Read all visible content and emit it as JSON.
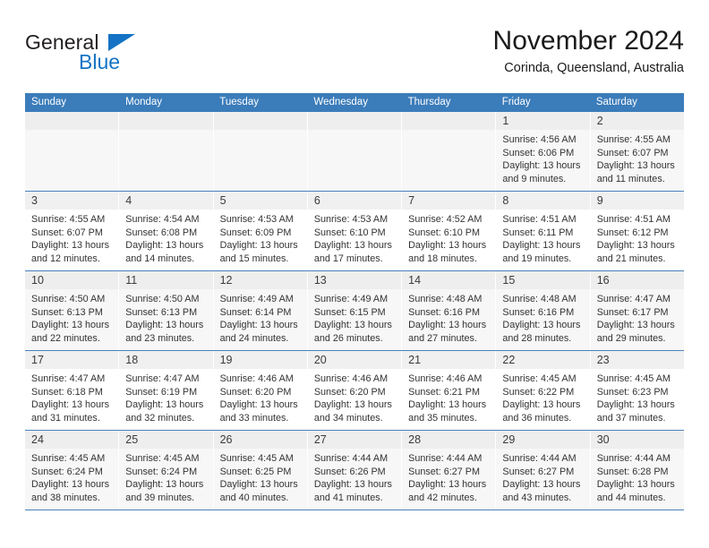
{
  "brand": {
    "word_one": "General",
    "word_two": "Blue",
    "accent_color": "#1473c4",
    "triangle_icon": "triangle-icon"
  },
  "header": {
    "title": "November 2024",
    "subtitle": "Corinda, Queensland, Australia"
  },
  "theme": {
    "header_blue": "#3b7cba",
    "row_divider": "#4a82bd",
    "band_gray": "#f0f0f0",
    "row_shade": "#f7f7f7"
  },
  "calendar": {
    "weekday_headers": [
      "Sunday",
      "Monday",
      "Tuesday",
      "Wednesday",
      "Thursday",
      "Friday",
      "Saturday"
    ],
    "weeks": [
      {
        "shaded": true,
        "days": [
          {
            "day": "",
            "lines": []
          },
          {
            "day": "",
            "lines": []
          },
          {
            "day": "",
            "lines": []
          },
          {
            "day": "",
            "lines": []
          },
          {
            "day": "",
            "lines": []
          },
          {
            "day": "1",
            "lines": [
              "Sunrise: 4:56 AM",
              "Sunset: 6:06 PM",
              "Daylight: 13 hours",
              "and 9 minutes."
            ]
          },
          {
            "day": "2",
            "lines": [
              "Sunrise: 4:55 AM",
              "Sunset: 6:07 PM",
              "Daylight: 13 hours",
              "and 11 minutes."
            ]
          }
        ]
      },
      {
        "shaded": false,
        "days": [
          {
            "day": "3",
            "lines": [
              "Sunrise: 4:55 AM",
              "Sunset: 6:07 PM",
              "Daylight: 13 hours",
              "and 12 minutes."
            ]
          },
          {
            "day": "4",
            "lines": [
              "Sunrise: 4:54 AM",
              "Sunset: 6:08 PM",
              "Daylight: 13 hours",
              "and 14 minutes."
            ]
          },
          {
            "day": "5",
            "lines": [
              "Sunrise: 4:53 AM",
              "Sunset: 6:09 PM",
              "Daylight: 13 hours",
              "and 15 minutes."
            ]
          },
          {
            "day": "6",
            "lines": [
              "Sunrise: 4:53 AM",
              "Sunset: 6:10 PM",
              "Daylight: 13 hours",
              "and 17 minutes."
            ]
          },
          {
            "day": "7",
            "lines": [
              "Sunrise: 4:52 AM",
              "Sunset: 6:10 PM",
              "Daylight: 13 hours",
              "and 18 minutes."
            ]
          },
          {
            "day": "8",
            "lines": [
              "Sunrise: 4:51 AM",
              "Sunset: 6:11 PM",
              "Daylight: 13 hours",
              "and 19 minutes."
            ]
          },
          {
            "day": "9",
            "lines": [
              "Sunrise: 4:51 AM",
              "Sunset: 6:12 PM",
              "Daylight: 13 hours",
              "and 21 minutes."
            ]
          }
        ]
      },
      {
        "shaded": true,
        "days": [
          {
            "day": "10",
            "lines": [
              "Sunrise: 4:50 AM",
              "Sunset: 6:13 PM",
              "Daylight: 13 hours",
              "and 22 minutes."
            ]
          },
          {
            "day": "11",
            "lines": [
              "Sunrise: 4:50 AM",
              "Sunset: 6:13 PM",
              "Daylight: 13 hours",
              "and 23 minutes."
            ]
          },
          {
            "day": "12",
            "lines": [
              "Sunrise: 4:49 AM",
              "Sunset: 6:14 PM",
              "Daylight: 13 hours",
              "and 24 minutes."
            ]
          },
          {
            "day": "13",
            "lines": [
              "Sunrise: 4:49 AM",
              "Sunset: 6:15 PM",
              "Daylight: 13 hours",
              "and 26 minutes."
            ]
          },
          {
            "day": "14",
            "lines": [
              "Sunrise: 4:48 AM",
              "Sunset: 6:16 PM",
              "Daylight: 13 hours",
              "and 27 minutes."
            ]
          },
          {
            "day": "15",
            "lines": [
              "Sunrise: 4:48 AM",
              "Sunset: 6:16 PM",
              "Daylight: 13 hours",
              "and 28 minutes."
            ]
          },
          {
            "day": "16",
            "lines": [
              "Sunrise: 4:47 AM",
              "Sunset: 6:17 PM",
              "Daylight: 13 hours",
              "and 29 minutes."
            ]
          }
        ]
      },
      {
        "shaded": false,
        "days": [
          {
            "day": "17",
            "lines": [
              "Sunrise: 4:47 AM",
              "Sunset: 6:18 PM",
              "Daylight: 13 hours",
              "and 31 minutes."
            ]
          },
          {
            "day": "18",
            "lines": [
              "Sunrise: 4:47 AM",
              "Sunset: 6:19 PM",
              "Daylight: 13 hours",
              "and 32 minutes."
            ]
          },
          {
            "day": "19",
            "lines": [
              "Sunrise: 4:46 AM",
              "Sunset: 6:20 PM",
              "Daylight: 13 hours",
              "and 33 minutes."
            ]
          },
          {
            "day": "20",
            "lines": [
              "Sunrise: 4:46 AM",
              "Sunset: 6:20 PM",
              "Daylight: 13 hours",
              "and 34 minutes."
            ]
          },
          {
            "day": "21",
            "lines": [
              "Sunrise: 4:46 AM",
              "Sunset: 6:21 PM",
              "Daylight: 13 hours",
              "and 35 minutes."
            ]
          },
          {
            "day": "22",
            "lines": [
              "Sunrise: 4:45 AM",
              "Sunset: 6:22 PM",
              "Daylight: 13 hours",
              "and 36 minutes."
            ]
          },
          {
            "day": "23",
            "lines": [
              "Sunrise: 4:45 AM",
              "Sunset: 6:23 PM",
              "Daylight: 13 hours",
              "and 37 minutes."
            ]
          }
        ]
      },
      {
        "shaded": true,
        "days": [
          {
            "day": "24",
            "lines": [
              "Sunrise: 4:45 AM",
              "Sunset: 6:24 PM",
              "Daylight: 13 hours",
              "and 38 minutes."
            ]
          },
          {
            "day": "25",
            "lines": [
              "Sunrise: 4:45 AM",
              "Sunset: 6:24 PM",
              "Daylight: 13 hours",
              "and 39 minutes."
            ]
          },
          {
            "day": "26",
            "lines": [
              "Sunrise: 4:45 AM",
              "Sunset: 6:25 PM",
              "Daylight: 13 hours",
              "and 40 minutes."
            ]
          },
          {
            "day": "27",
            "lines": [
              "Sunrise: 4:44 AM",
              "Sunset: 6:26 PM",
              "Daylight: 13 hours",
              "and 41 minutes."
            ]
          },
          {
            "day": "28",
            "lines": [
              "Sunrise: 4:44 AM",
              "Sunset: 6:27 PM",
              "Daylight: 13 hours",
              "and 42 minutes."
            ]
          },
          {
            "day": "29",
            "lines": [
              "Sunrise: 4:44 AM",
              "Sunset: 6:27 PM",
              "Daylight: 13 hours",
              "and 43 minutes."
            ]
          },
          {
            "day": "30",
            "lines": [
              "Sunrise: 4:44 AM",
              "Sunset: 6:28 PM",
              "Daylight: 13 hours",
              "and 44 minutes."
            ]
          }
        ]
      }
    ]
  }
}
